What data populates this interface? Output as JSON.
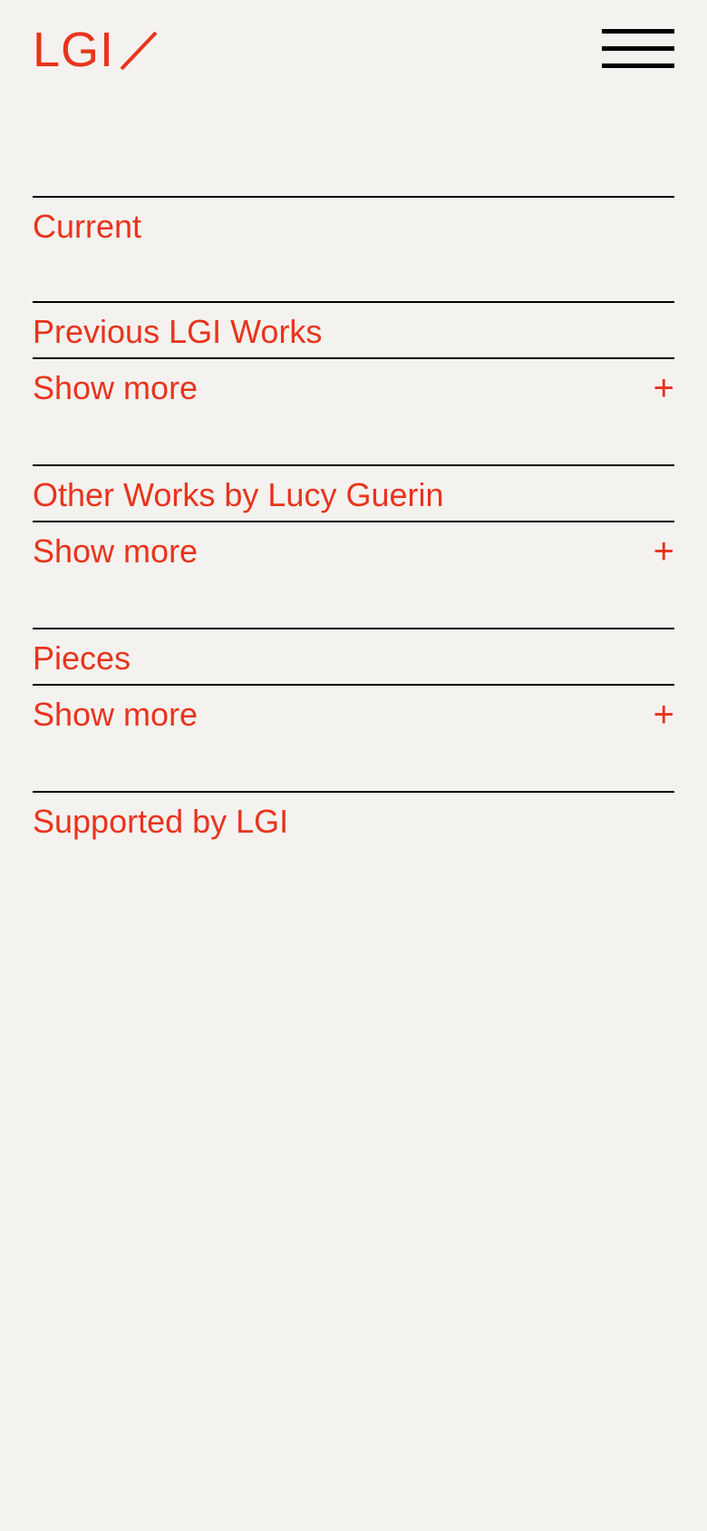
{
  "header": {
    "logo_text": "LGI",
    "menu_icon": "hamburger-menu-icon"
  },
  "sections": [
    {
      "title": "Current"
    },
    {
      "title": "Previous LGI Works",
      "show_more_label": "Show more",
      "expand_symbol": "+"
    },
    {
      "title": "Other Works by Lucy Guerin",
      "show_more_label": "Show more",
      "expand_symbol": "+"
    },
    {
      "title": "Pieces",
      "show_more_label": "Show more",
      "expand_symbol": "+"
    },
    {
      "title": "Supported by LGI"
    }
  ],
  "colors": {
    "accent": "#e8341c",
    "background": "#f4f2ef",
    "rule": "#000000"
  }
}
